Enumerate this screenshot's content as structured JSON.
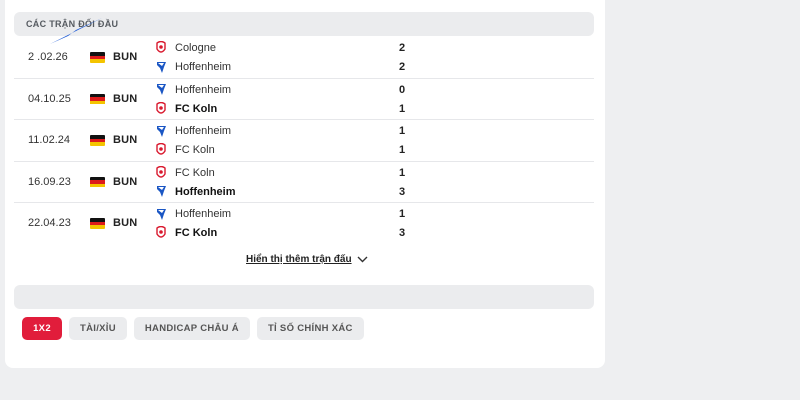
{
  "section": {
    "title": "CÁC TRẬN ĐỐI ĐẦU"
  },
  "matches": [
    {
      "date": "2 .02.26",
      "league": "BUN",
      "home": "Cologne",
      "away": "Hoffenheim",
      "home_score": "2",
      "away_score": "2",
      "home_logo": "koln-logo-icon",
      "away_logo": "hoffenheim-logo-icon",
      "bold_home": false,
      "bold_away": false
    },
    {
      "date": "04.10.25",
      "league": "BUN",
      "home": "Hoffenheim",
      "away": "FC Koln",
      "home_score": "0",
      "away_score": "1",
      "home_logo": "hoffenheim-logo-icon",
      "away_logo": "koln-logo-icon",
      "bold_home": false,
      "bold_away": true
    },
    {
      "date": "11.02.24",
      "league": "BUN",
      "home": "Hoffenheim",
      "away": "FC Koln",
      "home_score": "1",
      "away_score": "1",
      "home_logo": "hoffenheim-logo-icon",
      "away_logo": "koln-logo-icon",
      "bold_home": false,
      "bold_away": false
    },
    {
      "date": "16.09.23",
      "league": "BUN",
      "home": "FC Koln",
      "away": "Hoffenheim",
      "home_score": "1",
      "away_score": "3",
      "home_logo": "koln-logo-icon",
      "away_logo": "hoffenheim-logo-icon",
      "bold_home": false,
      "bold_away": true
    },
    {
      "date": "22.04.23",
      "league": "BUN",
      "home": "Hoffenheim",
      "away": "FC Koln",
      "home_score": "1",
      "away_score": "3",
      "home_logo": "hoffenheim-logo-icon",
      "away_logo": "koln-logo-icon",
      "bold_home": false,
      "bold_away": true
    }
  ],
  "more_link": {
    "label": "Hiển thị thêm trận đấu",
    "icon": "chevron-down-icon"
  },
  "tabs": [
    {
      "label": "1X2",
      "active": true
    },
    {
      "label": "TÀI/XỈU",
      "active": false
    },
    {
      "label": "HANDICAP CHÂU Á",
      "active": false
    },
    {
      "label": "TỈ SỐ CHÍNH XÁC",
      "active": false
    }
  ],
  "colors": {
    "accent": "#e11d3b",
    "pointer": "#1e5bd6",
    "hoffenheim_blue": "#1a56c4",
    "koln_red": "#d9192e"
  }
}
